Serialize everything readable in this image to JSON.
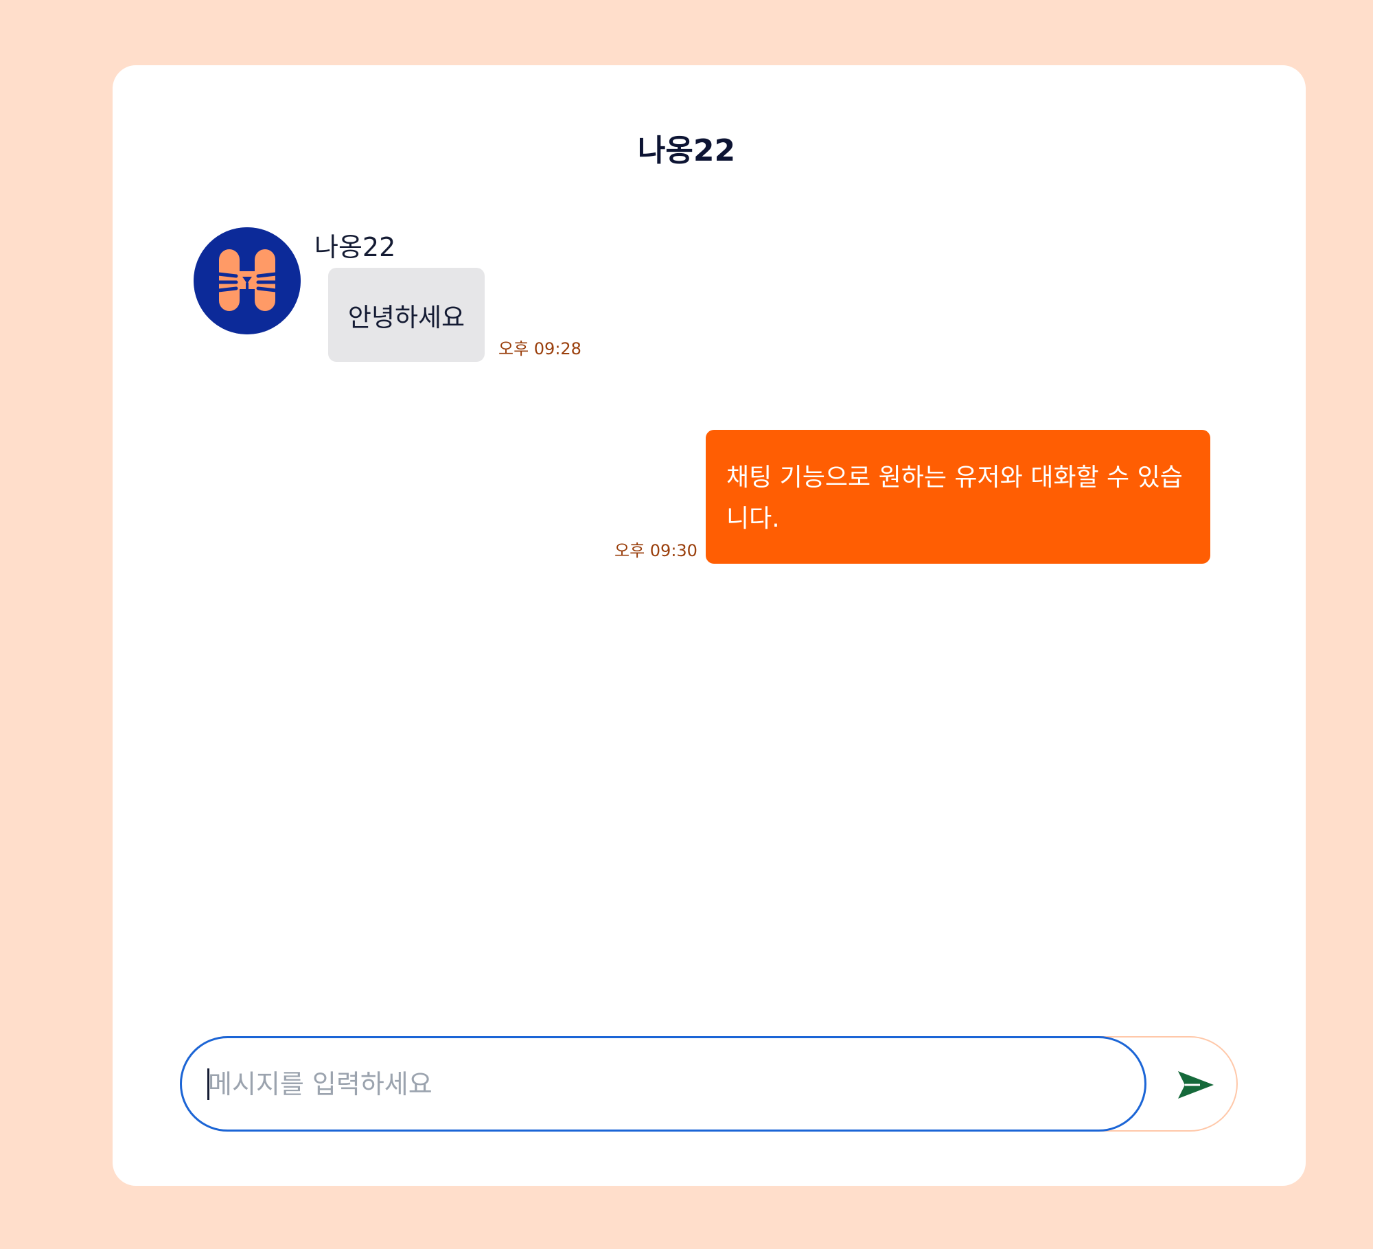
{
  "chat": {
    "title": "나옹22"
  },
  "messages": [
    {
      "direction": "incoming",
      "sender": "나옹22",
      "text": "안녕하세요",
      "time": "오후 09:28",
      "avatar_icon": "cat-face-logo-icon"
    },
    {
      "direction": "outgoing",
      "text": "채팅 기능으로 원하는 유저와 대화할 수 있습니다.",
      "time": "오후 09:30"
    }
  ],
  "composer": {
    "value": "",
    "placeholder": "메시지를 입력하세요",
    "send_icon": "send-arrow-icon"
  },
  "colors": {
    "page_background": "#FFDECB",
    "card_background": "#FFFFFF",
    "incoming_bubble": "#E6E6E8",
    "outgoing_bubble": "#FF5E03",
    "timestamp": "#9A3F0C",
    "avatar_background": "#0C2A99",
    "avatar_mark": "#FF9A66",
    "input_focus_border": "#1B65D6",
    "send_icon": "#15693A"
  }
}
